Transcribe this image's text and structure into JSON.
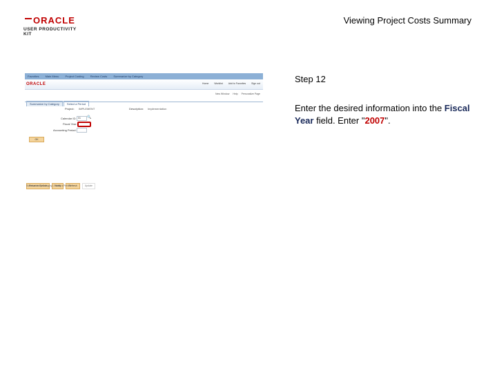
{
  "logo": {
    "brand": "ORACLE",
    "product": "USER PRODUCTIVITY KIT"
  },
  "title": "Viewing Project Costs Summary",
  "screenshot": {
    "nav": [
      "Favorites",
      "Main Menu",
      "Project Costing",
      "Review Costs",
      "Summarize by Category"
    ],
    "brand": "ORACLE",
    "top_links": [
      "Home",
      "Worklist",
      "Add to Favorites",
      "Sign out"
    ],
    "page_links": [
      "New Window",
      "Help",
      "Personalize Page"
    ],
    "tabs": [
      "Summarize by Category",
      "Select a Period"
    ],
    "project_label": "Project:",
    "project_value": "IMPLEMENT",
    "description_label": "Description:",
    "description_value": "Implementation",
    "calendar_label": "Calendar ID:",
    "calendar_value": "01",
    "fiscal_year_label": "Fiscal Year:",
    "accounting_period_label": "Accounting Period:",
    "ok_label": "OK",
    "buttons": [
      "Return to Search",
      "Notify",
      "Refresh",
      "Update"
    ],
    "footnote": "Summarize by Category | Select a Period"
  },
  "step": "Step 12",
  "instruction": {
    "part1": "Enter the desired information into the ",
    "field": "Fiscal Year",
    "part2": " field. Enter \"",
    "value": "2007",
    "part3": "\"."
  }
}
